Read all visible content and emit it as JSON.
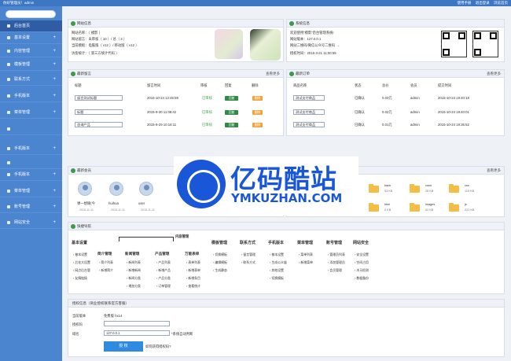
{
  "topbar": {
    "left": "你好管理员！admin",
    "links": [
      "使用手册",
      "退出登录",
      "浏览首页"
    ]
  },
  "sidebar": {
    "items": [
      {
        "label": "后台首页",
        "active": true,
        "plus": false
      },
      {
        "label": "基本设置",
        "plus": true
      },
      {
        "label": "内容管理",
        "plus": true
      },
      {
        "label": "模板管理",
        "plus": true
      },
      {
        "label": "联系方式",
        "plus": true
      },
      {
        "label": "手机版本",
        "plus": true
      },
      {
        "label": "菜单管理",
        "plus": true
      },
      {
        "label": "",
        "plus": false
      },
      {
        "label": "手机版本",
        "plus": true
      },
      {
        "label": "",
        "plus": false
      },
      {
        "label": "手机版本",
        "plus": true
      },
      {
        "label": "菜单管理",
        "plus": true
      },
      {
        "label": "账号管理",
        "plus": true
      },
      {
        "label": "网站安全",
        "plus": true
      }
    ]
  },
  "site_info": {
    "title": "网站信息",
    "lines": [
      "网站名称：（ 模影 ）",
      "网站留言：未审核（ 10 ）/ 总（ 3 ）",
      "当前模板：电脑版（ v12 ）/ 移动版（ v12 ）",
      "访客统计：（ 第三方统计代码 ）"
    ]
  },
  "sys_info": {
    "title": "系统信息",
    "lines": [
      "欢迎使用“模影”后台管理系统!",
      "网站版本：127.0.0.1",
      "网站二维码/微信公众号二维码 →",
      "授权时间：2016-3-21 11:00:55"
    ]
  },
  "messages": {
    "title": "最新留言",
    "more": "查看更多",
    "headers": [
      "标题",
      "留言时间",
      "审核",
      "回复",
      "删除"
    ],
    "rows": [
      {
        "title": "留言测试标题",
        "time": "2015-10-24 12:45:59",
        "status": "已审核",
        "reply": "回复",
        "del": "删除"
      },
      {
        "title": "标题",
        "time": "2015-9-30 11:08:42",
        "status": "已审核",
        "reply": "回复",
        "del": "删除"
      },
      {
        "title": "咨询产品",
        "time": "2015-9-29 10:18:11",
        "status": "已审核",
        "reply": "回复",
        "del": "删除"
      }
    ]
  },
  "orders": {
    "title": "最新订单",
    "more": "查看更多",
    "headers": [
      "商品名称",
      "状态",
      "总价",
      "会员",
      "提交时间"
    ],
    "rows": [
      {
        "name": "测试支付商品",
        "status": "已确认",
        "price": "0.03元",
        "member": "admin",
        "time": "2015-10-24 19:40:18"
      },
      {
        "name": "测试支付商品",
        "status": "已确认",
        "price": "0.02元",
        "member": "admin",
        "time": "2015-10-24 19:40:01"
      },
      {
        "name": "测试支付商品",
        "status": "已确认",
        "price": "0.01元",
        "member": "admin",
        "time": "2015-10-24 19:35:52"
      }
    ]
  },
  "members": {
    "title": "最新会员",
    "more": "查看更多",
    "users": [
      {
        "name": "弹一想琢(今",
        "date": "2015-11-11"
      },
      {
        "name": "huihua",
        "date": "2015-11-11"
      },
      {
        "name": "user",
        "date": "2015-11-11"
      }
    ]
  },
  "files": {
    "title": "",
    "more": "查看更多",
    "items": [
      {
        "name": "backup",
        "size": "0 KB"
      },
      {
        "name": "bank",
        "size": "53 KB"
      },
      {
        "name": "conn",
        "size": "28 KB"
      },
      {
        "name": "css",
        "size": "119 KB"
      },
      {
        "name": "data",
        "size": "3.73 MB"
      },
      {
        "name": "html",
        "size": "0 KB"
      },
      {
        "name": "images",
        "size": "52 KB"
      },
      {
        "name": "js",
        "size": "221 KB"
      }
    ]
  },
  "watermark": {
    "brand": "亿码酷站",
    "domain": "YMKUZHAN.COM"
  },
  "quick_nav": {
    "title": "快捷导航",
    "top": "内容管理",
    "cols": [
      {
        "head": "基本设置",
        "items": [
          "基本设置",
          "后花大设置",
          "网点后台管",
          "友情链接"
        ]
      },
      {
        "head": "简介管理",
        "items": [
          "简介列表",
          "新增简介"
        ]
      },
      {
        "head": "新闻管理",
        "items": [
          "新闻列表",
          "新增新闻",
          "新闻分类",
          "增加分类"
        ]
      },
      {
        "head": "产品管理",
        "items": [
          "产品列表",
          "新增产品",
          "产品分类",
          "订单管理"
        ]
      },
      {
        "head": "万能表单",
        "items": [
          "表单列表",
          "新增表单",
          "新增条目",
          "查看统计"
        ]
      },
      {
        "head": "模板管理",
        "items": [
          "切换模板",
          "编辑模板",
          "生成静态"
        ]
      },
      {
        "head": "联系方式",
        "items": [
          "留言管理",
          "联系方式"
        ]
      },
      {
        "head": "手机版本",
        "items": [
          "基本设置",
          "生成公众量",
          "其他设置",
          "切换模板"
        ]
      },
      {
        "head": "菜单管理",
        "items": [
          "菜单列表",
          "新增菜单"
        ]
      },
      {
        "head": "账号管理",
        "items": [
          "管理员列表",
          "添加管理员",
          "会员管理"
        ]
      },
      {
        "head": "网站安全",
        "items": [
          "安全设置",
          "空间占用",
          "木马检测",
          "数据备份"
        ]
      }
    ]
  },
  "auth": {
    "title": "授权信息（商业授权联系官方客服）",
    "labels": [
      "当前版本",
      "授权码",
      "域名"
    ],
    "version": "免费版 hx14",
    "domain_value": "127.0.0.1",
    "hint": "*系统自动判断",
    "button": "授 权",
    "link": "如何获得授权码?"
  }
}
